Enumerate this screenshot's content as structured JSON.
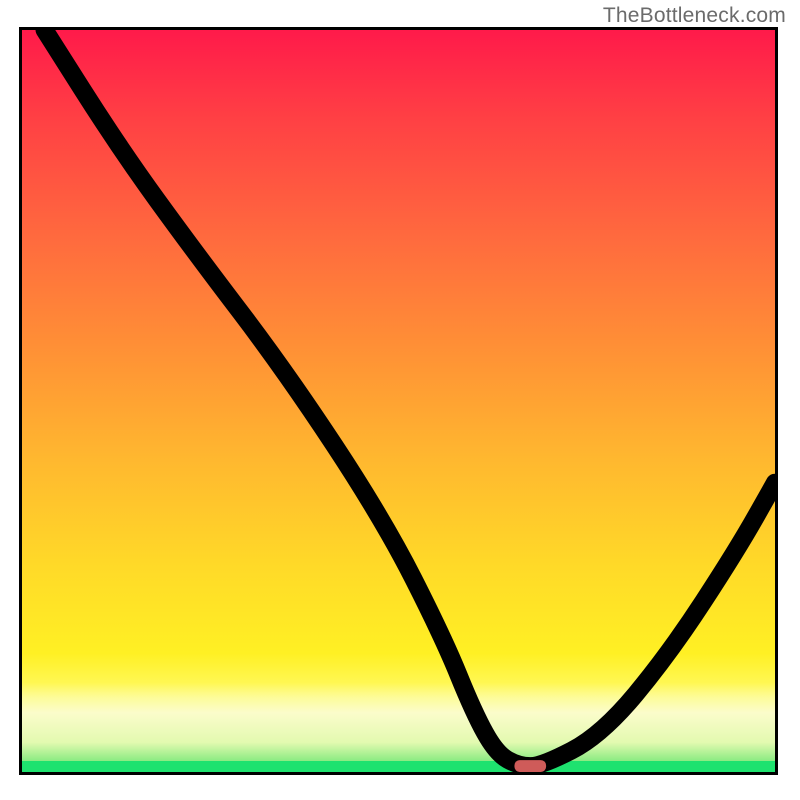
{
  "watermark": "TheBottleneck.com",
  "chart_data": {
    "type": "line",
    "title": "",
    "xlabel": "",
    "ylabel": "",
    "xlim": [
      0,
      100
    ],
    "ylim": [
      0,
      100
    ],
    "x": [
      3,
      13,
      23,
      35,
      48,
      56,
      60,
      63,
      66,
      69,
      77,
      86,
      95,
      100
    ],
    "values": [
      100,
      84,
      70,
      54,
      34,
      18,
      8,
      2.5,
      0.8,
      0.8,
      5,
      16,
      30,
      39
    ],
    "note": "V-shaped bottleneck curve over a red→green vertical gradient; minimum (optimal) sits near x≈66–69% at y≈0.8%. Values are read off pixel geometry — the source image has no visible axis ticks/labels, so x and y are normalized 0–100.",
    "marker": {
      "x": 67.5,
      "y": 0.8,
      "shape": "rounded-bar",
      "color": "#cf5b59"
    },
    "gradient_stops": [
      {
        "pct": 0,
        "color": "#ff1a4a"
      },
      {
        "pct": 44,
        "color": "#ff9335"
      },
      {
        "pct": 84,
        "color": "#fff024"
      },
      {
        "pct": 96,
        "color": "#e3fab0"
      },
      {
        "pct": 100,
        "color": "#1ee26f"
      }
    ]
  }
}
